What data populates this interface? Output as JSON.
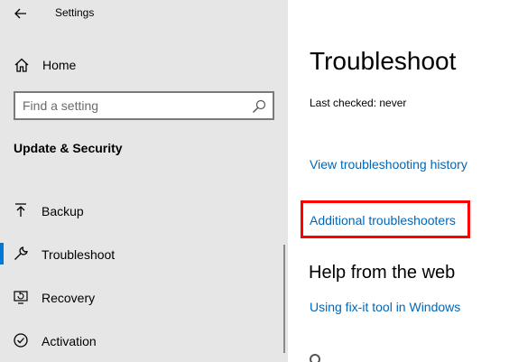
{
  "window": {
    "title": "Settings"
  },
  "sidebar": {
    "home_label": "Home",
    "search": {
      "placeholder": "Find a setting",
      "value": ""
    },
    "section_title": "Update & Security",
    "items": [
      {
        "label": "Backup",
        "icon": "backup-arrow-icon",
        "selected": false
      },
      {
        "label": "Troubleshoot",
        "icon": "wrench-icon",
        "selected": true
      },
      {
        "label": "Recovery",
        "icon": "recovery-icon",
        "selected": false
      },
      {
        "label": "Activation",
        "icon": "activation-check-icon",
        "selected": false
      }
    ]
  },
  "main": {
    "title": "Troubleshoot",
    "last_checked": "Last checked: never",
    "links": {
      "history": "View troubleshooting history",
      "additional": "Additional troubleshooters"
    },
    "help_heading": "Help from the web",
    "help_links": [
      "Using fix-it tool in Windows"
    ]
  },
  "colors": {
    "sidebar_bg": "#e6e6e6",
    "accent": "#0078d7",
    "link": "#0067b8",
    "highlight": "#ff0000"
  }
}
